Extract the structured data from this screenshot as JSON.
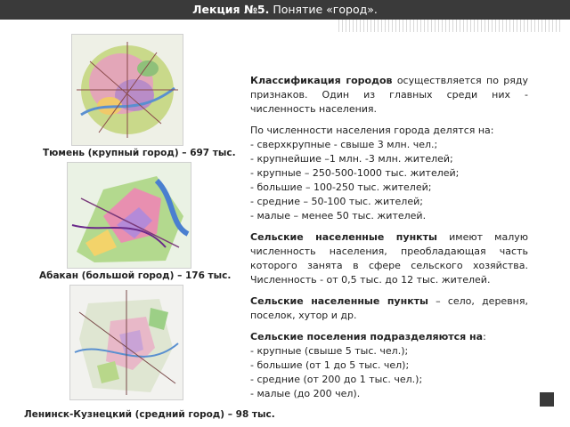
{
  "slide": {
    "title_bold": "Лекция №5.",
    "title_rest": " Понятие «город».",
    "maps": [
      {
        "caption": "Тюмень (крупный город) – 697 тыс."
      },
      {
        "caption": "Абакан (большой город) – 176 тыс."
      },
      {
        "caption": "Ленинск-Кузнецкий (средний город) – 98 тыс."
      }
    ],
    "p1_bold": "Классификация городов",
    "p1_rest": " осуществляется по ряду признаков. Один из главных среди них - численность населения.",
    "p2_intro": "По численности населения города делятся на:",
    "p2_items": [
      "- сверхкрупные - свыше 3 млн. чел.;",
      "- крупнейшие –1 млн. -3 млн. жителей;",
      "- крупные – 250-500-1000 тыс. жителей;",
      "- большие – 100-250 тыс. жителей;",
      "- средние – 50-100 тыс. жителей;",
      "- малые – менее 50 тыс. жителей."
    ],
    "p3_bold": "Сельские населенные пункты",
    "p3_rest": " имеют малую численность населения, преобладающая часть которого занята в сфере сельского хозяйства. Численность - от 0,5 тыс. до 12 тыс. жителей.",
    "p4_bold": "Сельские населенные пункты",
    "p4_rest": " – село, деревня, поселок, хутор и др.",
    "p5_bold": "Сельские поселения подразделяются на",
    "p5_rest": ":",
    "p5_items": [
      "- крупные (свыше 5 тыс. чел.);",
      "- большие (от 1 до 5 тыс. чел);",
      "- средние (от 200 до 1 тыс. чел.);",
      "- малые (до 200 чел)."
    ]
  }
}
